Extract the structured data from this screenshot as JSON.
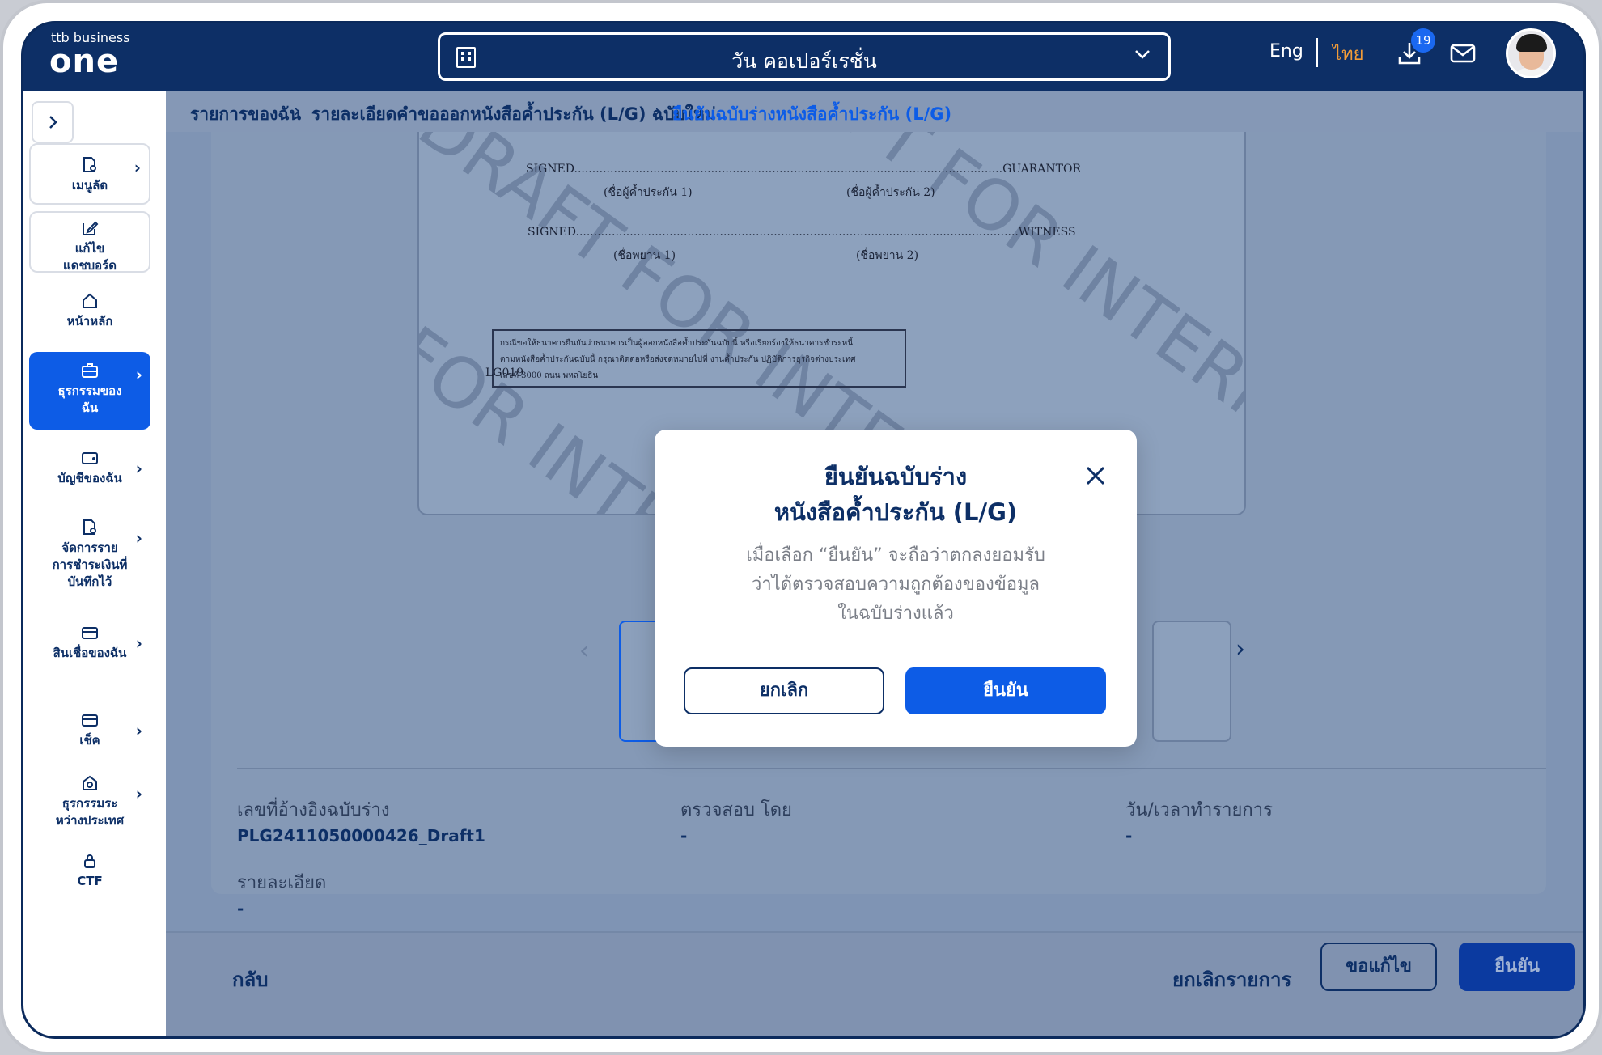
{
  "header": {
    "logo_small": "ttb business",
    "logo_big": "one",
    "company_name": "วัน คอเปอร์เรชั่น",
    "lang_eng": "Eng",
    "lang_thai": "ไทย",
    "download_badge": "19"
  },
  "sidebar": {
    "items": [
      {
        "label": "เมนูลัด"
      },
      {
        "label": "แก้ไข\nแดชบอร์ด"
      },
      {
        "label": "หน้าหลัก"
      },
      {
        "label": "ธุรกรรมของ\nฉัน"
      },
      {
        "label": "บัญชีของฉัน"
      },
      {
        "label": "จัดการราย\nการชำระเงินที่\nบันทึกไว้"
      },
      {
        "label": "สินเชื่อของฉัน"
      },
      {
        "label": "เช็ค"
      },
      {
        "label": "ธุรกรรมระ\nหว่างประเทศ"
      },
      {
        "label": "CTF"
      }
    ]
  },
  "breadcrumb": {
    "item1": "รายการของฉัน",
    "item2": "รายละเอียดคำขอออกหนังสือค้ำประกัน (L/G) ฉบับใหม่",
    "item3": "ยืนยันฉบับร่างหนังสือค้ำประกัน (L/G)"
  },
  "document": {
    "watermark": "DRAFT FOR INTERNAL USE ONLY",
    "signed1": "SIGNED.......................................................................................................................GUARANTOR",
    "guarantor1": "(ชื่อผู้ค้ำประกัน 1)",
    "guarantor2": "(ชื่อผู้ค้ำประกัน 2)",
    "signed2": "SIGNED...........................................................................................................................WITNESS",
    "witness1": "(ชื่อพยาน 1)",
    "witness2": "(ชื่อพยาน 2)",
    "box_line1": "กรณีขอให้ธนาคารยืนยันว่าธนาคารเป็นผู้ออกหนังสือค้ำประกันฉบับนี้ หรือเรียกร้องให้ธนาคารชำระหนี้",
    "box_line2": "ตามหนังสือค้ำประกันฉบับนี้ กรุณาติดต่อหรือส่งจดหมายไปที่ งานค้ำประกัน ปฏิบัติการธุรกิจต่างประเทศ",
    "box_line3": "เลขที่ 3000 ถนน พหลโยธิน",
    "code": "LG019"
  },
  "details": {
    "ref_label": "เลขที่อ้างอิงฉบับร่าง",
    "ref_value": "PLG2411050000426_Draft1",
    "checked_label": "ตรวจสอบ โดย",
    "checked_value": "-",
    "datetime_label": "วัน/เวลาทำรายการ",
    "datetime_value": "-",
    "detail_label": "รายละเอียด",
    "detail_value": "-"
  },
  "footer": {
    "back": "กลับ",
    "cancel_tx": "ยกเลิกรายการ",
    "request_edit": "ขอแก้ไข",
    "confirm": "ยืนยัน"
  },
  "modal": {
    "title_line1": "ยืนยันฉบับร่าง",
    "title_line2": "หนังสือค้ำประกัน (L/G)",
    "desc_line1": "เมื่อเลือก “ยืนยัน” จะถือว่าตกลงยอมรับ",
    "desc_line2": "ว่าได้ตรวจสอบความถูกต้องของข้อมูล",
    "desc_line3": "ในฉบับร่างแล้ว",
    "cancel": "ยกเลิก",
    "confirm": "ยืนยัน"
  },
  "colors": {
    "brand_navy": "#0d2f66",
    "primary_blue": "#0d5ce6",
    "lang_active": "#f29c38"
  }
}
